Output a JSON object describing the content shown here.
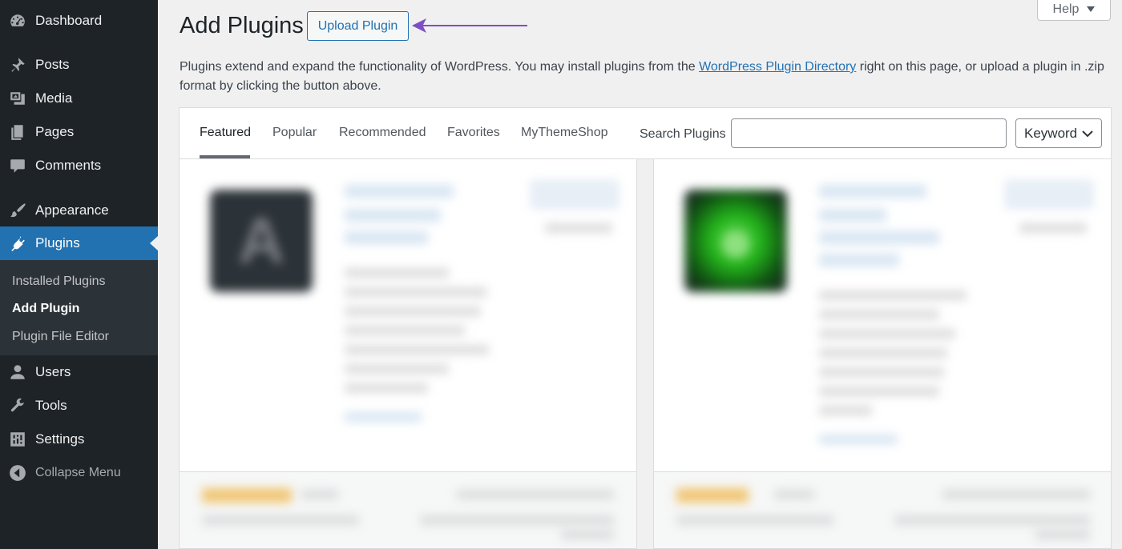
{
  "sidebar": {
    "items": [
      {
        "label": "Dashboard",
        "icon": "dashboard-icon"
      },
      {
        "label": "Posts",
        "icon": "pin-icon"
      },
      {
        "label": "Media",
        "icon": "media-icon"
      },
      {
        "label": "Pages",
        "icon": "pages-icon"
      },
      {
        "label": "Comments",
        "icon": "comment-icon"
      },
      {
        "label": "Appearance",
        "icon": "brush-icon"
      },
      {
        "label": "Plugins",
        "icon": "plug-icon"
      },
      {
        "label": "Users",
        "icon": "user-icon"
      },
      {
        "label": "Tools",
        "icon": "wrench-icon"
      },
      {
        "label": "Settings",
        "icon": "settings-icon"
      },
      {
        "label": "Collapse Menu",
        "icon": "collapse-icon"
      }
    ],
    "submenu": [
      "Installed Plugins",
      "Add Plugin",
      "Plugin File Editor"
    ],
    "active_item": "Plugins",
    "current_submenu": "Add Plugin"
  },
  "help": {
    "label": "Help"
  },
  "header": {
    "title": "Add Plugins",
    "upload_button": "Upload Plugin"
  },
  "description": {
    "before_link": "Plugins extend and expand the functionality of WordPress. You may install plugins from the ",
    "link_text": "WordPress Plugin Directory",
    "after_link": " right on this page, or upload a plugin in .zip format by clicking the button above."
  },
  "filter": {
    "tabs": [
      "Featured",
      "Popular",
      "Recommended",
      "Favorites",
      "MyThemeShop"
    ],
    "current_tab": "Featured",
    "search_label": "Search Plugins",
    "search_value": "",
    "search_type": "Keyword"
  },
  "colors": {
    "sidebar_bg": "#1d2327",
    "active_bg": "#2271b1",
    "link": "#2271b1",
    "arrow": "#7e4fc4"
  }
}
